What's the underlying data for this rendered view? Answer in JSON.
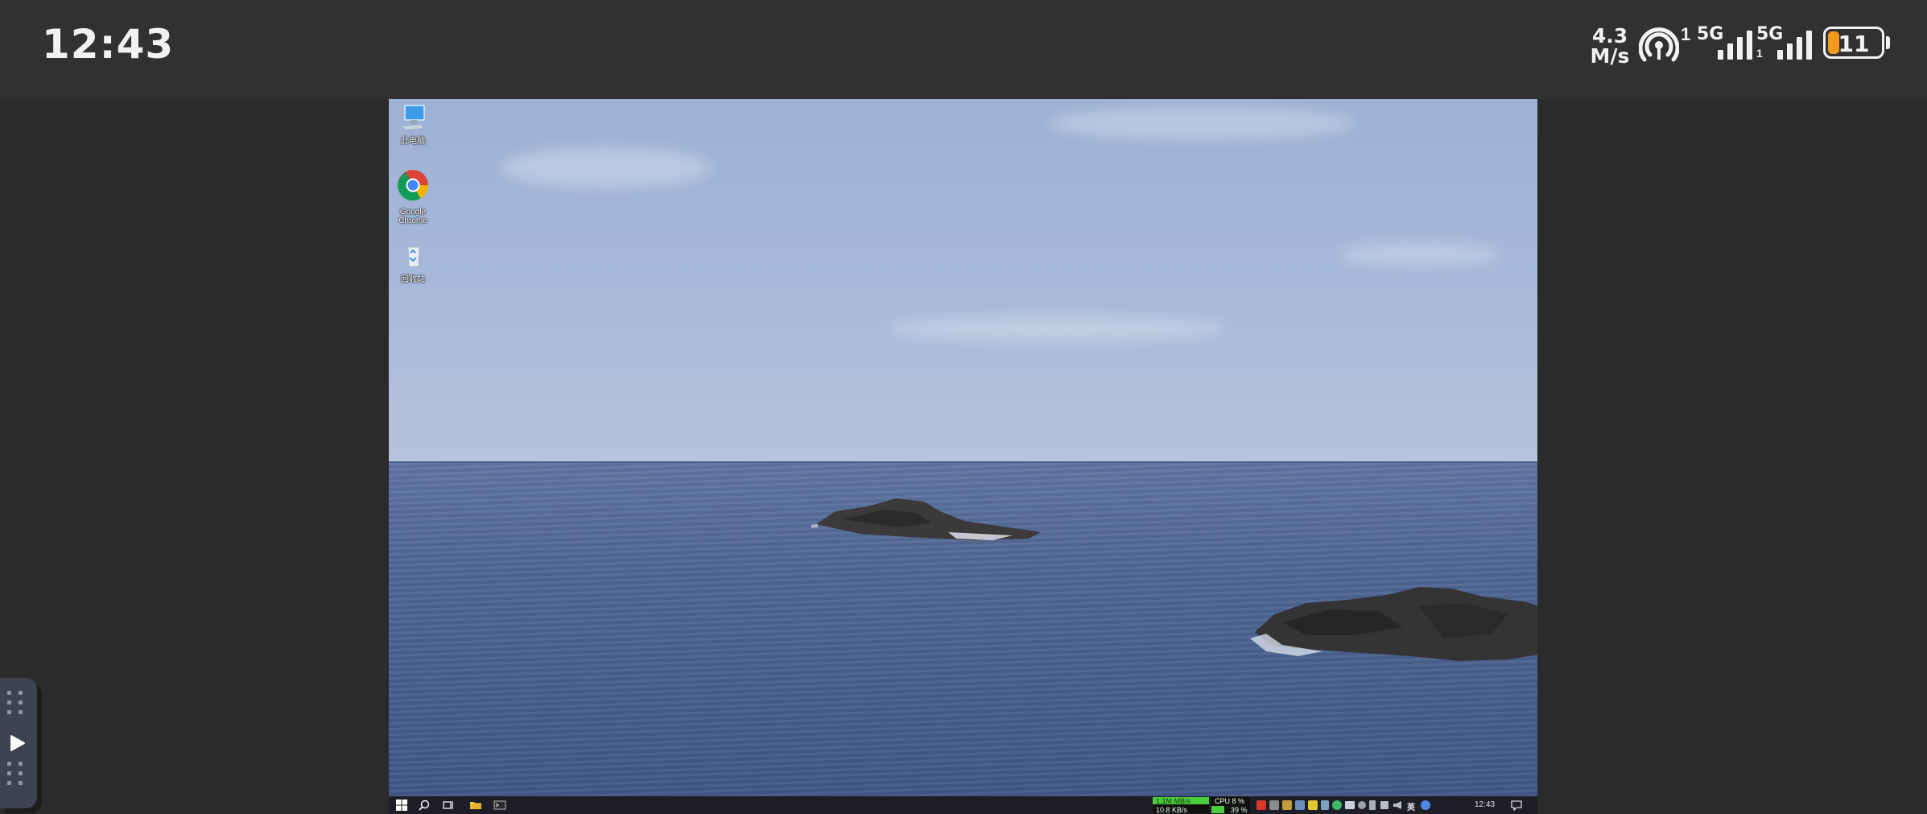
{
  "status_bar": {
    "time": "12:43",
    "net_speed_value": "4.3",
    "net_speed_unit": "M/s",
    "hotspot_icon": "hotspot-icon",
    "hotspot_count": "1",
    "sim1_label": "5G",
    "sim2_label": "5G",
    "sim2_sub": "1",
    "battery_level": "11",
    "battery_color": "#f29a1a"
  },
  "desktop": {
    "icons": [
      {
        "icon": "computer-icon",
        "label": "此电脑"
      },
      {
        "icon": "chrome-icon",
        "label": "Google Chrome"
      },
      {
        "icon": "recycle-bin-icon",
        "label": "回收站"
      }
    ]
  },
  "taskbar": {
    "start_icon": "windows-start-icon",
    "search_icon": "search-icon",
    "task_view_icon": "task-view-icon",
    "explorer_icon": "file-explorer-icon",
    "terminal_icon": "terminal-icon",
    "net_meter_up": "1.1M MB/s",
    "net_meter_down": "10.8 KB/s",
    "cpu_meter": "CPU 8 %",
    "mem_meter": "39 %",
    "ime_label": "英",
    "clock": "12:43"
  },
  "floating_control": {
    "play_icon": "play-icon"
  }
}
